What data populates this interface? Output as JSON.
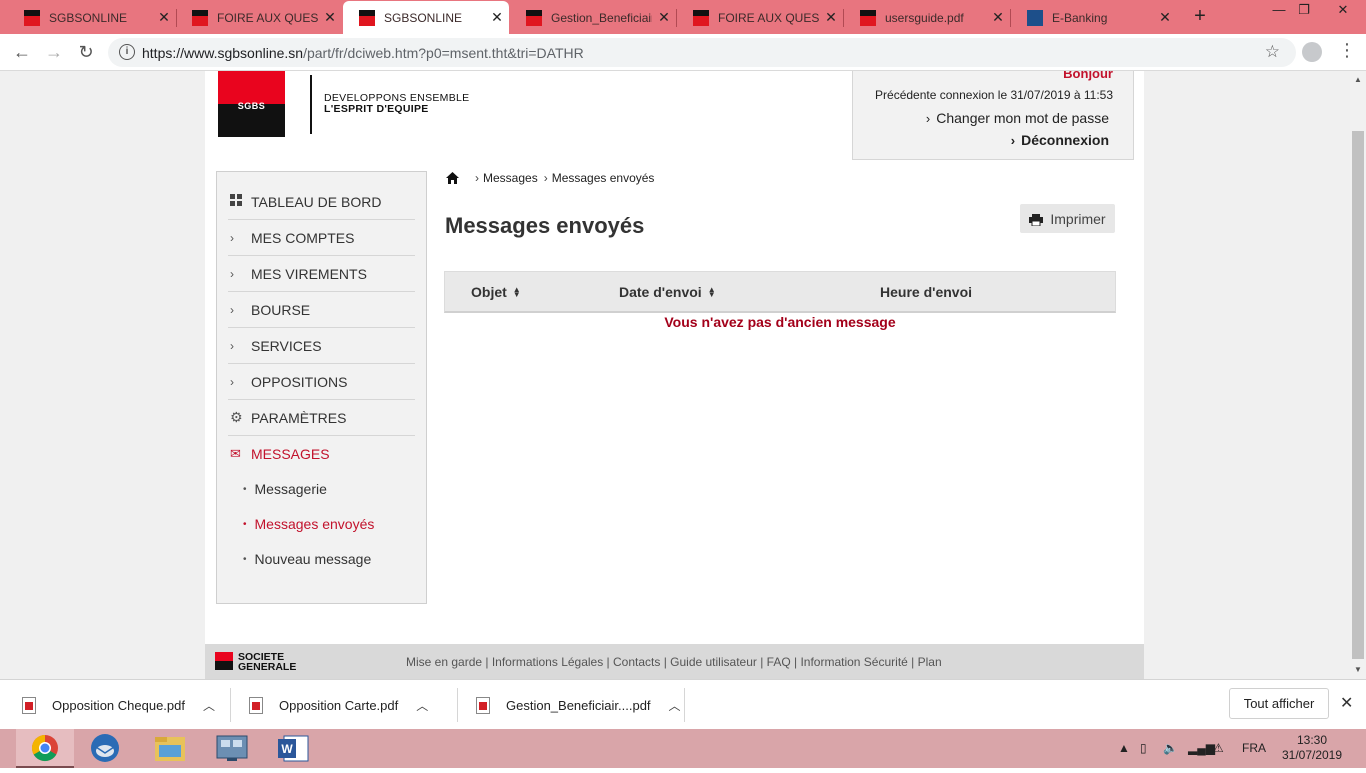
{
  "browser": {
    "tabs": [
      {
        "label": "SGBSONLINE",
        "icon": "sg-favicon",
        "active": false
      },
      {
        "label": "FOIRE AUX QUESTIONS",
        "icon": "sg-favicon",
        "active": false
      },
      {
        "label": "SGBSONLINE",
        "icon": "sg-favicon",
        "active": true
      },
      {
        "label": "Gestion_Beneficiaires",
        "icon": "sg-favicon",
        "active": false
      },
      {
        "label": "FOIRE AUX QUESTIONS",
        "icon": "sg-favicon",
        "active": false
      },
      {
        "label": "usersguide.pdf",
        "icon": "sg-favicon",
        "active": false
      },
      {
        "label": "E-Banking",
        "icon": "ebanking-favicon",
        "active": false
      }
    ],
    "url_host": "https://www.sgbsonline.sn",
    "url_path": "/part/fr/dciweb.htm?p0=msent.tht&tri=DATHR"
  },
  "header": {
    "logo_text": "SGBS",
    "tagline_line1": "DEVELOPPONS ENSEMBLE",
    "tagline_line2": "L'ESPRIT D'EQUIPE",
    "greeting": "Bonjour",
    "last_login": "Précédente connexion  le 31/07/2019 à 11:53",
    "change_password": "Changer mon mot de passe",
    "logout": "Déconnexion"
  },
  "sidebar": {
    "items": [
      {
        "label": "TABLEAU DE BORD",
        "icon": "dashboard-icon"
      },
      {
        "label": "MES COMPTES",
        "icon": "chevron-right-icon"
      },
      {
        "label": "MES VIREMENTS",
        "icon": "chevron-right-icon"
      },
      {
        "label": "BOURSE",
        "icon": "chevron-right-icon"
      },
      {
        "label": "SERVICES",
        "icon": "chevron-right-icon"
      },
      {
        "label": "OPPOSITIONS",
        "icon": "chevron-right-icon"
      },
      {
        "label": "PARAMÈTRES",
        "icon": "gear-icon"
      },
      {
        "label": "MESSAGES",
        "icon": "envelope-icon",
        "active": true
      }
    ],
    "subitems": [
      {
        "label": "Messagerie"
      },
      {
        "label": "Messages envoyés",
        "active": true
      },
      {
        "label": "Nouveau message"
      }
    ]
  },
  "breadcrumb": {
    "items": [
      "Messages",
      "Messages envoyés"
    ]
  },
  "main": {
    "title": "Messages envoyés",
    "print_label": "Imprimer",
    "columns": [
      "Objet",
      "Date d'envoi",
      "Heure d'envoi"
    ],
    "empty_message": "Vous n'avez pas d'ancien message"
  },
  "footer": {
    "brand_line1": "SOCIETE",
    "brand_line2": "GENERALE",
    "links": "Mise en garde | Informations Légales | Contacts | Guide utilisateur | FAQ | Information Sécurité | Plan"
  },
  "downloads": {
    "items": [
      "Opposition Cheque.pdf",
      "Opposition Carte.pdf",
      "Gestion_Beneficiair....pdf"
    ],
    "show_all": "Tout afficher"
  },
  "taskbar": {
    "language": "FRA",
    "time": "13:30",
    "date": "31/07/2019"
  },
  "colors": {
    "brand_red": "#e9041e",
    "accent_red": "#c2122c",
    "tabbar": "#e8757f",
    "taskbar": "#d9a5a9"
  }
}
